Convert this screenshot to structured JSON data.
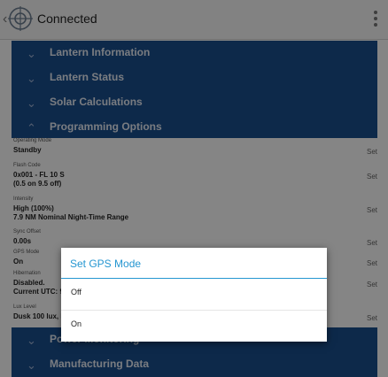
{
  "header": {
    "title": "Connected"
  },
  "sections": [
    {
      "label": "Lantern Information",
      "expanded": false
    },
    {
      "label": "Lantern Status",
      "expanded": false
    },
    {
      "label": "Solar Calculations",
      "expanded": false
    },
    {
      "label": "Programming Options",
      "expanded": true
    },
    {
      "label": "Power Monitoring",
      "expanded": false
    },
    {
      "label": "Manufacturing Data",
      "expanded": false
    }
  ],
  "settings": [
    {
      "caption": "Operating Mode",
      "value1": "Standby",
      "value2": "",
      "set": "Set"
    },
    {
      "caption": "Flash Code",
      "value1": "0x001 - FL 10 S",
      "value2": "(0.5 on 9.5 off)",
      "set": "Set"
    },
    {
      "caption": "Intensity",
      "value1": "High (100%)",
      "value2": "7.9 NM Nominal Night-Time Range",
      "set": "Set"
    },
    {
      "caption": "Sync Offset",
      "value1": "0.00s",
      "value2": "",
      "set": "Set"
    },
    {
      "caption": "GPS Mode",
      "value1": "On",
      "value2": "",
      "set": "Set"
    },
    {
      "caption": "Hibernation",
      "value1": "Disabled.",
      "value2": "Current UTC: 9",
      "set": "Set"
    },
    {
      "caption": "Lux Level",
      "value1": "Dusk 100 lux, D",
      "value2": "",
      "set": "Set"
    }
  ],
  "dialog": {
    "title": "Set GPS Mode",
    "options": [
      "Off",
      "On"
    ]
  },
  "colors": {
    "panel": "#1a4f8e",
    "accent": "#2596d1"
  }
}
